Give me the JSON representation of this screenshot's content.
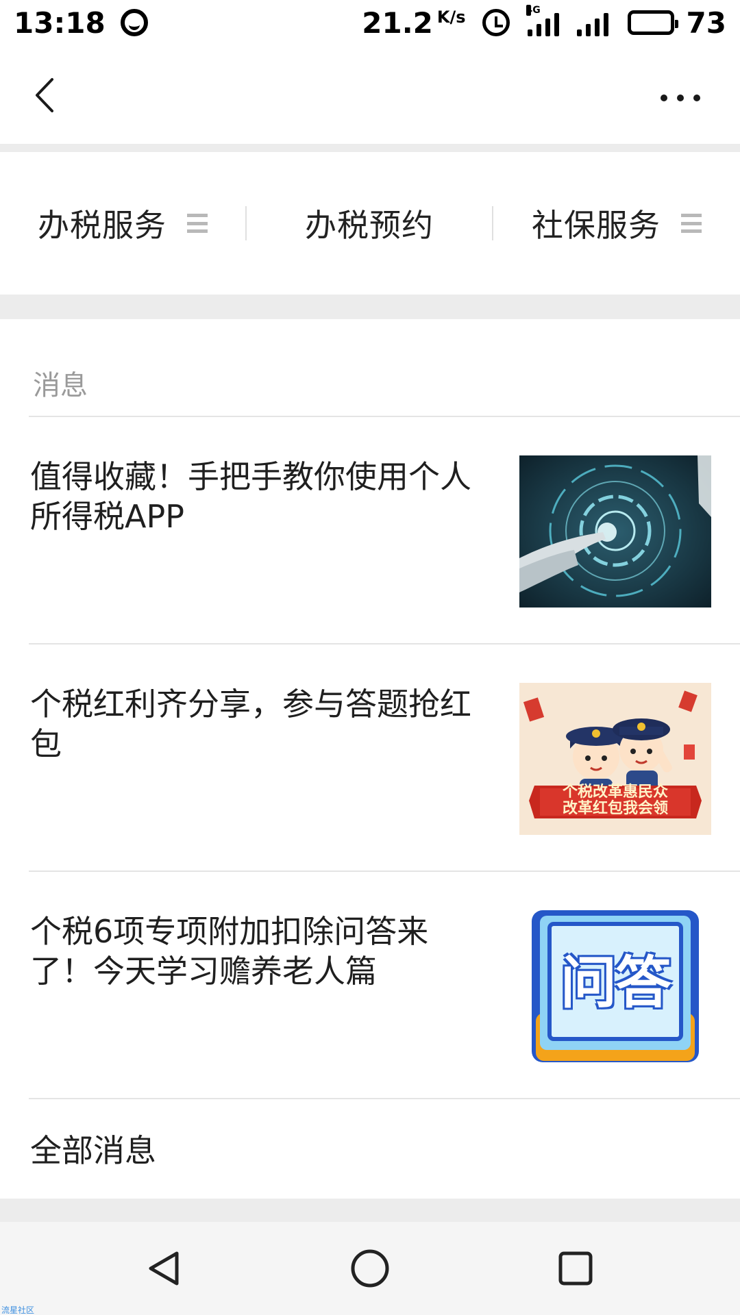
{
  "status_bar": {
    "time": "13:18",
    "net_speed": "21.2",
    "net_speed_unit": "K/s",
    "net_type": "4G",
    "battery_level": 73,
    "battery_text": "73"
  },
  "nav": {
    "back_icon": "chevron-left-icon",
    "more_icon": "more-horizontal-icon"
  },
  "menu": {
    "items": [
      {
        "label": "办税服务",
        "has_submenu": true
      },
      {
        "label": "办税预约",
        "has_submenu": false
      },
      {
        "label": "社保服务",
        "has_submenu": true
      }
    ]
  },
  "messages": {
    "section_title": "消息",
    "items": [
      {
        "title": "值得收藏！手把手教你使用个人所得税APP",
        "thumbnail": "finger-touching-digital-dial"
      },
      {
        "title": "个税红利齐分享，参与答题抢红包",
        "thumbnail": "cartoon-tax-officers-red-envelope"
      },
      {
        "title": "个税6项专项附加扣除问答来了！今天学习赡养老人篇",
        "thumbnail": "qa-badge"
      }
    ],
    "thumb_texts": {
      "banner_line1": "个税改革惠民众",
      "banner_line2": "改革红包我会领",
      "qa_badge": "问答"
    },
    "view_all_label": "全部消息"
  },
  "system_nav": {
    "back": "triangle-back-icon",
    "home": "circle-home-icon",
    "recents": "square-recents-icon"
  },
  "watermark": "流星社区",
  "colors": {
    "background": "#ffffff",
    "separator": "#ececec",
    "muted_text": "#9a9a9a",
    "primary_text": "#1f1f1f",
    "system_nav_bg": "#f5f5f5"
  }
}
